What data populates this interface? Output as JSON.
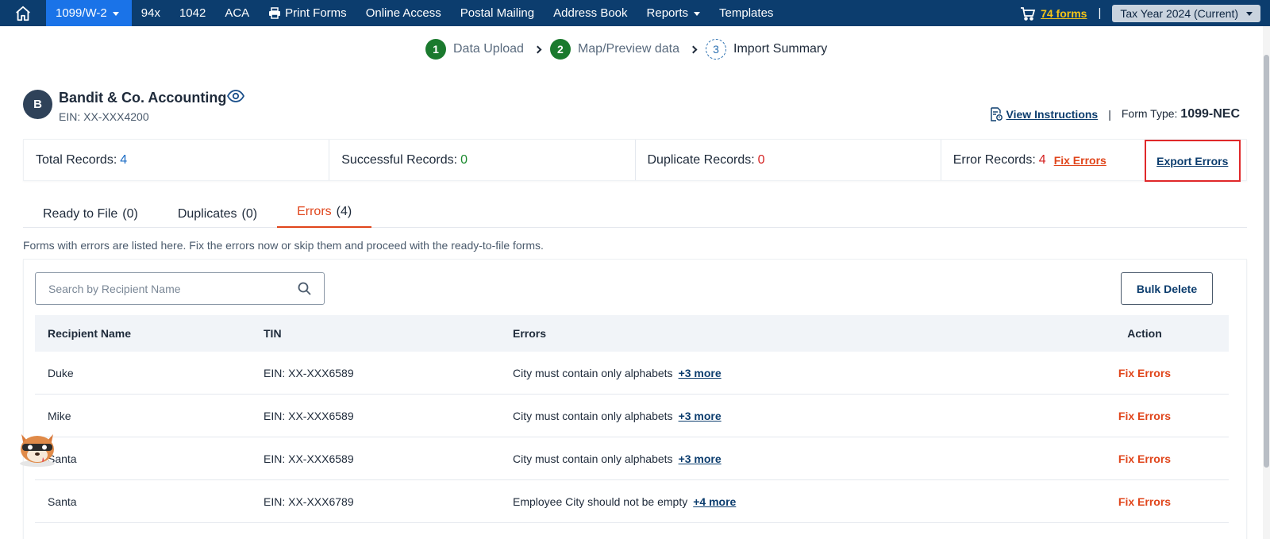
{
  "nav": {
    "items": [
      {
        "label": "1099/W-2",
        "active": true,
        "dropdown": true
      },
      {
        "label": "94x"
      },
      {
        "label": "1042"
      },
      {
        "label": "ACA"
      },
      {
        "label": "Print Forms",
        "icon": "printer-icon"
      },
      {
        "label": "Online Access"
      },
      {
        "label": "Postal Mailing"
      },
      {
        "label": "Address Book"
      },
      {
        "label": "Reports",
        "dropdown": true
      },
      {
        "label": "Templates"
      }
    ],
    "cart_label": "74 forms",
    "separator": "|",
    "tax_year": "Tax Year 2024 (Current)"
  },
  "stepper": {
    "steps": [
      {
        "num": "1",
        "label": "Data Upload",
        "state": "done"
      },
      {
        "num": "2",
        "label": "Map/Preview data",
        "state": "done"
      },
      {
        "num": "3",
        "label": "Import Summary",
        "state": "current"
      }
    ]
  },
  "company": {
    "initial": "B",
    "name": "Bandit & Co. Accounting",
    "ein": "EIN: XX-XXX4200",
    "view_instructions": "View Instructions",
    "separator": "|",
    "form_type_label": "Form Type:",
    "form_type": "1099-NEC"
  },
  "summary": {
    "total_label": "Total Records:",
    "total_value": "4",
    "success_label": "Successful Records:",
    "success_value": "0",
    "dup_label": "Duplicate Records:",
    "dup_value": "0",
    "error_label": "Error Records:",
    "error_value": "4",
    "fix_errors": "Fix Errors",
    "export_errors": "Export Errors"
  },
  "tabs": [
    {
      "label": "Ready to File",
      "count": "(0)"
    },
    {
      "label": "Duplicates",
      "count": "(0)"
    },
    {
      "label": "Errors",
      "count": "(4)",
      "active": true
    }
  ],
  "help_text": "Forms with errors are listed here. Fix the errors now or skip them and proceed with the ready-to-file forms.",
  "search": {
    "placeholder": "Search by Recipient Name"
  },
  "bulk_delete": "Bulk Delete",
  "table": {
    "headers": [
      "Recipient Name",
      "TIN",
      "Errors",
      "Action"
    ],
    "rows": [
      {
        "name": "Duke",
        "tin": "EIN: XX-XXX6589",
        "error": "City must contain only alphabets",
        "more": "+3 more",
        "action": "Fix Errors"
      },
      {
        "name": "Mike",
        "tin": "EIN: XX-XXX6589",
        "error": "City must contain only alphabets",
        "more": "+3 more",
        "action": "Fix Errors"
      },
      {
        "name": "Santa",
        "tin": "EIN: XX-XXX6589",
        "error": "City must contain only alphabets",
        "more": "+3 more",
        "action": "Fix Errors"
      },
      {
        "name": "Santa",
        "tin": "EIN: XX-XXX6789",
        "error": "Employee City should not be empty",
        "more": "+4 more",
        "action": "Fix Errors"
      }
    ]
  },
  "colors": {
    "nav_bg": "#0c3d6e",
    "nav_active": "#1a73e8",
    "accent_orange": "#e0451b",
    "success_green": "#1b7a2e",
    "highlight_red": "#e0282a"
  }
}
